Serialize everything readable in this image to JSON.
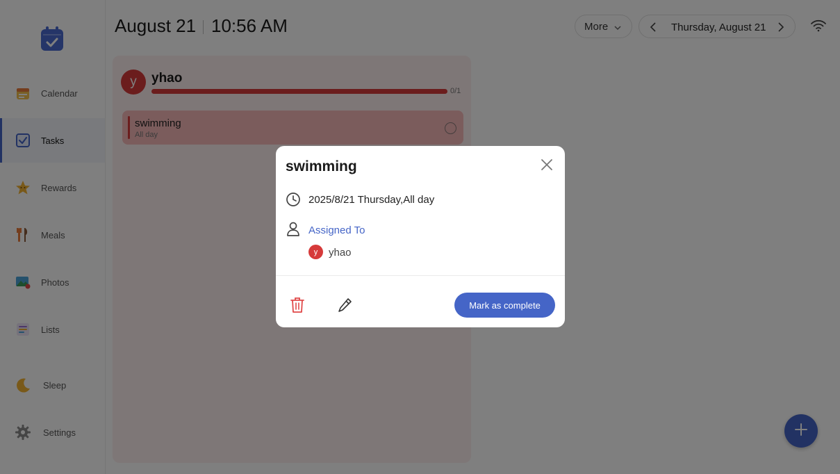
{
  "header": {
    "date": "August 21",
    "time": "10:56 AM",
    "more_label": "More",
    "nav_date": "Thursday, August 21"
  },
  "sidebar": {
    "items": [
      {
        "label": "Calendar",
        "icon": "calendar-icon"
      },
      {
        "label": "Tasks",
        "icon": "tasks-checkbox-icon",
        "active": true
      },
      {
        "label": "Rewards",
        "icon": "star-icon"
      },
      {
        "label": "Meals",
        "icon": "utensils-icon"
      },
      {
        "label": "Photos",
        "icon": "photo-icon"
      },
      {
        "label": "Lists",
        "icon": "list-icon"
      },
      {
        "label": "Sleep",
        "icon": "moon-icon"
      },
      {
        "label": "Settings",
        "icon": "gear-icon"
      }
    ]
  },
  "board": {
    "member_initial": "y",
    "member_name": "yhao",
    "progress_text": "0/1",
    "progress_fraction": 0,
    "task": {
      "title": "swimming",
      "subtitle": "All day"
    }
  },
  "modal": {
    "title": "swimming",
    "datetime": "2025/8/21 Thursday,All day",
    "assigned_label": "Assigned To",
    "assignee_initial": "y",
    "assignee_name": "yhao",
    "complete_label": "Mark as complete"
  },
  "colors": {
    "accent": "#4565c7",
    "member": "#d63a3a",
    "board_bg": "#fdeeee",
    "task_bg": "#f6b8b8"
  }
}
